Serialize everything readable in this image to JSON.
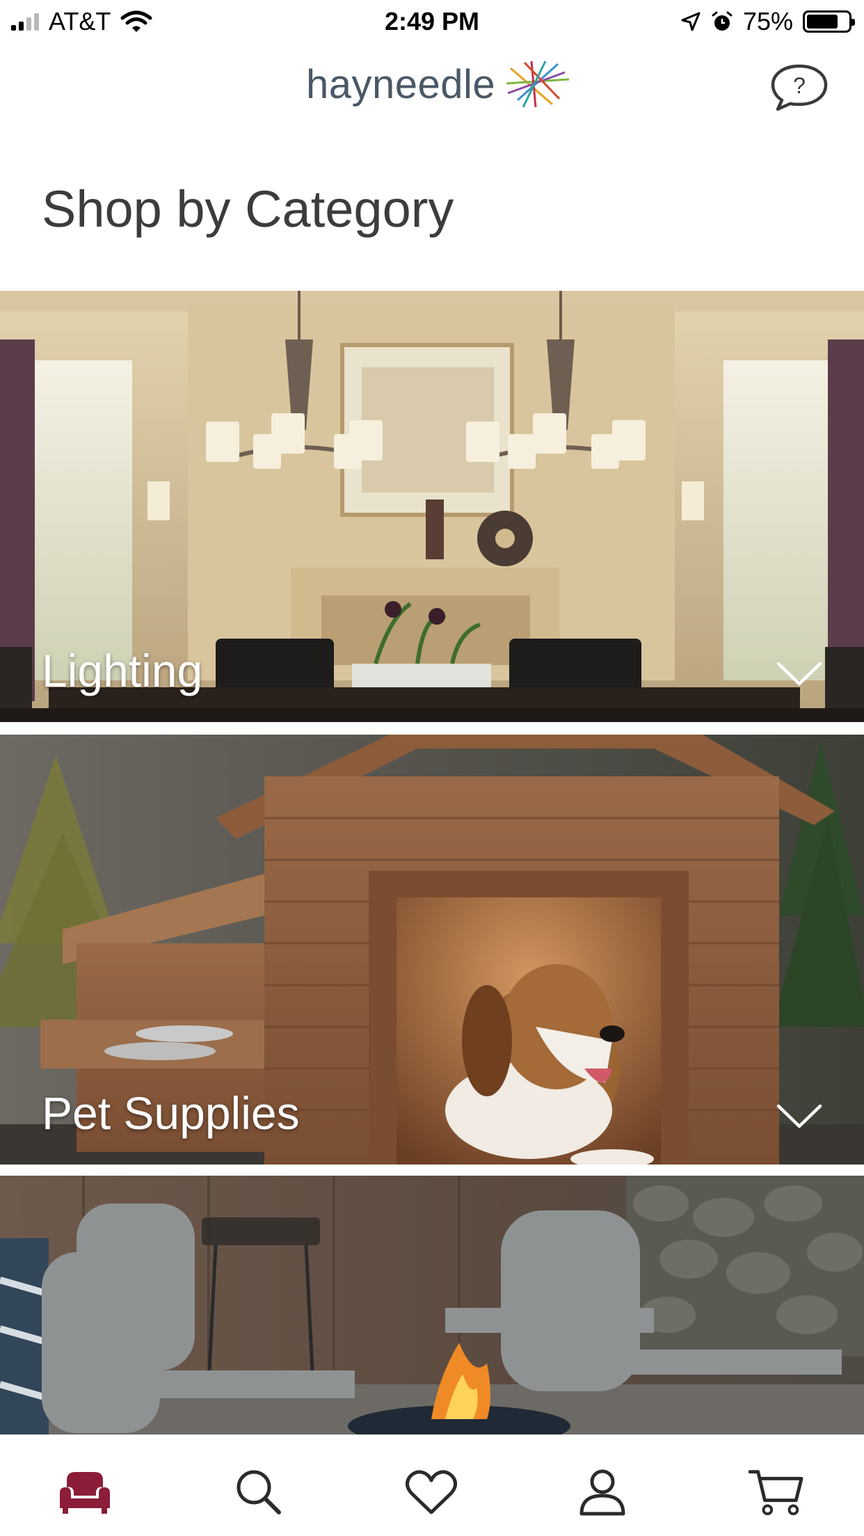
{
  "status_bar": {
    "carrier": "AT&T",
    "time": "2:49 PM",
    "battery_percent_label": "75%",
    "battery_level": 0.75
  },
  "header": {
    "logo_text": "hayneedle"
  },
  "page": {
    "title": "Shop by Category"
  },
  "categories": [
    {
      "label": "Lighting"
    },
    {
      "label": "Pet Supplies"
    },
    {
      "label": ""
    }
  ],
  "tab_bar": {
    "active_tab": "home",
    "active_color": "#8b1d38",
    "icons": [
      "sofa-icon",
      "search-icon",
      "heart-icon",
      "account-icon",
      "cart-icon"
    ]
  }
}
